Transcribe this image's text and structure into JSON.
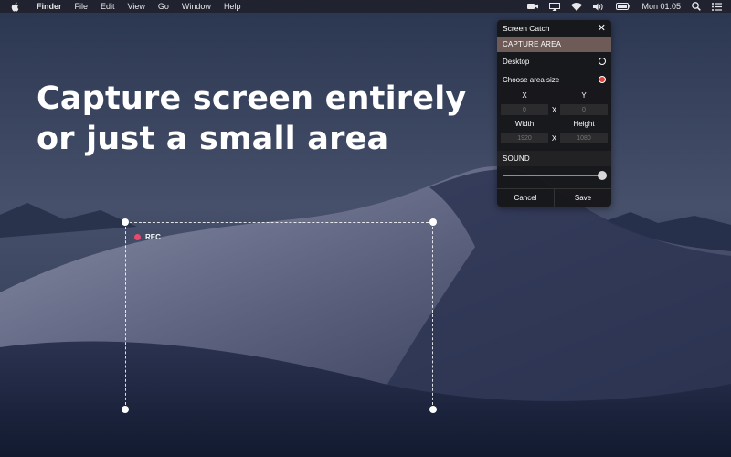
{
  "menubar": {
    "app_name": "Finder",
    "items": [
      "File",
      "Edit",
      "View",
      "Go",
      "Window",
      "Help"
    ],
    "clock": "Mon 01:05",
    "status_icons": [
      "video-camera-icon",
      "airplay-icon",
      "wifi-icon",
      "volume-icon",
      "battery-icon",
      "search-icon",
      "list-icon"
    ]
  },
  "headline": {
    "line1": "Capture screen entirely",
    "line2": "or just a small area"
  },
  "selection": {
    "rec_label": "REC",
    "rec_color": "#e84a6e"
  },
  "panel": {
    "title": "Screen Catch",
    "close_glyph": "✕",
    "capture_area_label": "CAPTURE AREA",
    "options": [
      {
        "label": "Desktop",
        "selected": false
      },
      {
        "label": "Choose area size",
        "selected": true
      }
    ],
    "x_label": "X",
    "y_label": "Y",
    "separator": "X",
    "x_placeholder": "0",
    "y_placeholder": "0",
    "width_label": "Width",
    "height_label": "Height",
    "width_placeholder": "1920",
    "height_placeholder": "1080",
    "sound_label": "SOUND",
    "sound_level": 0.97,
    "cancel_label": "Cancel",
    "save_label": "Save",
    "header_color": "#6e5b58",
    "accent_color": "#2ec27e",
    "radio_selected_color": "#e0433c"
  }
}
